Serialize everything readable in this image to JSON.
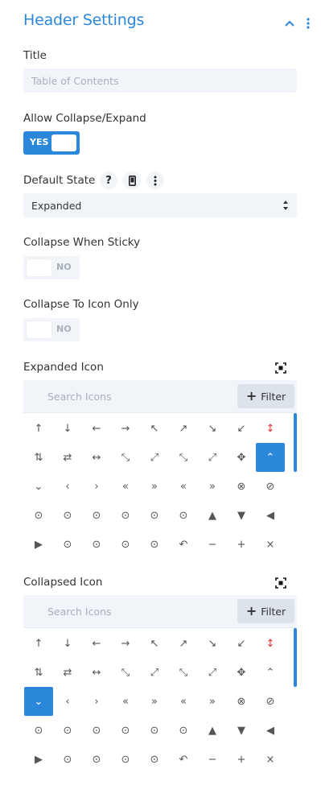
{
  "section": {
    "title": "Header Settings"
  },
  "fields": {
    "title_label": "Title",
    "title_placeholder": "Table of Contents",
    "allow_collapse_label": "Allow Collapse/Expand",
    "allow_collapse_toggle": "YES",
    "default_state_label": "Default State",
    "default_state_help": "?",
    "default_state_value": "Expanded",
    "collapse_sticky_label": "Collapse When Sticky",
    "collapse_sticky_toggle": "NO",
    "collapse_icon_only_label": "Collapse To Icon Only",
    "collapse_icon_only_toggle": "NO"
  },
  "expanded_picker": {
    "label": "Expanded Icon",
    "search_placeholder": "Search Icons",
    "filter_label": "Filter",
    "selected_index": 17
  },
  "collapsed_picker": {
    "label": "Collapsed Icon",
    "search_placeholder": "Search Icons",
    "filter_label": "Filter",
    "selected_index": 18
  },
  "icons": [
    "↑",
    "↓",
    "←",
    "→",
    "↖",
    "↗",
    "↘",
    "↙",
    "↕",
    "⇅",
    "⇄",
    "↔",
    "⤡",
    "⤢",
    "⤡",
    "⤢",
    "✥",
    "⌃",
    "⌄",
    "‹",
    "›",
    "«",
    "»",
    "«",
    "»",
    "⊗",
    "⊘",
    "⊙",
    "⊙",
    "⊙",
    "⊙",
    "⊙",
    "⊙",
    "▲",
    "▼",
    "◀",
    "▶",
    "⊙",
    "⊙",
    "⊙",
    "⊙",
    "↶",
    "−",
    "+",
    "×"
  ],
  "icon_names": [
    "arrow-up",
    "arrow-down",
    "arrow-left",
    "arrow-right",
    "arrow-up-left",
    "arrow-up-right",
    "arrow-down-right",
    "arrow-down-left",
    "arrow-up-down",
    "arrows-vertical",
    "arrows-horizontal-swap",
    "arrow-left-right",
    "expand-diagonal",
    "expand-diagonal-alt",
    "collapse-diagonal",
    "expand-out",
    "move",
    "chevron-up",
    "chevron-down",
    "chevron-left",
    "chevron-right",
    "double-chevron-up",
    "double-chevron-down",
    "double-chevron-left",
    "double-chevron-right",
    "circle-chevron-up",
    "circle-chevron-down",
    "circle-chevron-left",
    "circle-chevron-right",
    "circle-double-up",
    "circle-double-down",
    "circle-double-left",
    "circle-double-right",
    "caret-up",
    "caret-down",
    "caret-left",
    "caret-right",
    "circle-caret-up",
    "circle-caret-down",
    "circle-caret-left",
    "circle-caret-right",
    "undo",
    "minus",
    "plus",
    "close"
  ],
  "colors": {
    "accent": "#2b87da",
    "muted_bg": "#f1f5f9",
    "placeholder": "#a7b0ba"
  }
}
